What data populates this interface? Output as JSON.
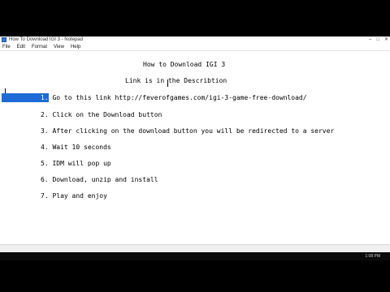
{
  "window": {
    "title": "How To Download IGI 3 - Notepad",
    "controls": [
      "–",
      "□",
      "✕"
    ]
  },
  "menu": [
    "File",
    "Edit",
    "Format",
    "View",
    "Help"
  ],
  "document": {
    "heading1": "How to Download IGI 3",
    "heading2": "Link is in the Describtion",
    "steps": [
      {
        "num": "1.",
        "text": "Go to this link http://feverofgames.com/igi-3-game-free-download/"
      },
      {
        "num": "2.",
        "text": "Click on the Download button"
      },
      {
        "num": "3.",
        "text": "After clicking on the download button you will be redirected to a server"
      },
      {
        "num": "4.",
        "text": "Wait 10 seconds"
      },
      {
        "num": "5.",
        "text": "IDM will pop up"
      },
      {
        "num": "6.",
        "text": "Download, unzip and install"
      },
      {
        "num": "7.",
        "text": "Play and enjoy"
      }
    ]
  },
  "taskbar": {
    "clock": "1:08 PM"
  }
}
